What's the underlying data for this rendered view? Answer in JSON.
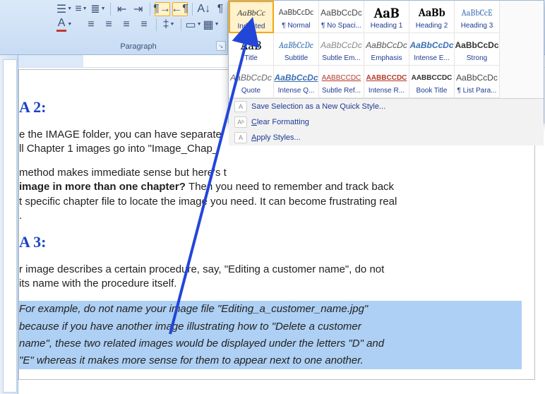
{
  "ribbon": {
    "paragraph_label": "Paragraph"
  },
  "styles": {
    "rows": [
      [
        {
          "preview": "AaBbCc",
          "name": "Indented",
          "css": "font-style:italic;font-family:Georgia,serif;color:#333"
        },
        {
          "preview": "AaBbCcDc",
          "name": "¶ Normal",
          "css": "font-family:Calibri;color:#444"
        },
        {
          "preview": "AaBbCcDc",
          "name": "¶ No Spaci...",
          "css": "color:#444"
        },
        {
          "preview": "AaB",
          "name": "Heading 1",
          "css": "font-family:Cambria,serif;font-size:20px;font-weight:bold;color:#000"
        },
        {
          "preview": "AaBb",
          "name": "Heading 2",
          "css": "font-family:Cambria,serif;font-size:16px;font-weight:bold;color:#000"
        },
        {
          "preview": "AaBbCcE",
          "name": "Heading 3",
          "css": "color:#3a6fb3;font-family:Cambria,serif"
        }
      ],
      [
        {
          "preview": "AaB",
          "name": "Title",
          "css": "font-family:Cambria,serif;font-size:18px;color:#000"
        },
        {
          "preview": "AaBbCcDc",
          "name": "Subtitle",
          "css": "font-style:italic;color:#3a6fb3;font-family:Cambria,serif"
        },
        {
          "preview": "AaBbCcDc",
          "name": "Subtle Em...",
          "css": "font-style:italic;color:#888"
        },
        {
          "preview": "AaBbCcDc",
          "name": "Emphasis",
          "css": "font-style:italic;color:#555"
        },
        {
          "preview": "AaBbCcDc",
          "name": "Intense E...",
          "css": "font-style:italic;font-weight:bold;color:#3a6fb3"
        },
        {
          "preview": "AaBbCcDc",
          "name": "Strong",
          "css": "font-weight:bold;color:#333"
        }
      ],
      [
        {
          "preview": "AaBbCcDc",
          "name": "Quote",
          "css": "font-style:italic;color:#666"
        },
        {
          "preview": "AaBbCcDc",
          "name": "Intense Q...",
          "css": "font-style:italic;font-weight:bold;color:#3a6fb3;text-decoration:underline"
        },
        {
          "preview": "AABBCCDC",
          "name": "Subtle Ref...",
          "css": "color:#b33a2a;text-decoration:underline;font-size:10px"
        },
        {
          "preview": "AABBCCDC",
          "name": "Intense R...",
          "css": "color:#b33a2a;font-weight:bold;text-decoration:underline;font-size:10px"
        },
        {
          "preview": "AABBCCDC",
          "name": "Book Title",
          "css": "color:#333;font-weight:bold;font-size:10px"
        },
        {
          "preview": "AaBbCcDc",
          "name": "¶ List Para...",
          "css": "color:#444"
        }
      ]
    ],
    "menu": {
      "save_new": "Save Selection as a New Quick Style...",
      "clear": "Clear Formatting",
      "apply": "Apply Styles..."
    }
  },
  "doc": {
    "idea2_h": "A 2:",
    "idea2_p1a": "e the IMAGE folder, you can have separate",
    "idea2_p1b": "ll Chapter 1 images go into \"Image_Chap_",
    "idea2_p2a": "method makes immediate sense but here's t",
    "idea2_p2b_bold": " image in more than one chapter? ",
    "idea2_p2b_post": "Then you need to remember and track back",
    "idea2_p2c": "t specific chapter file to locate the image you need. It can become frustrating real",
    "idea2_p2d": ".",
    "idea3_h": "A 3:",
    "idea3_p1a": "r image describes a certain procedure, say, \"Editing a customer name\", do not",
    "idea3_p1b": "its name with the procedure itself.",
    "sel_l1": "For example, do not name your image file \"Editing_a_customer_name.jpg\"",
    "sel_l2": "because if you have another image illustrating how to \"Delete a customer",
    "sel_l3": "name\", these two related images would be displayed under the letters \"D\" and",
    "sel_l4": "\"E\" whereas it makes more sense for them to appear next to one another."
  }
}
